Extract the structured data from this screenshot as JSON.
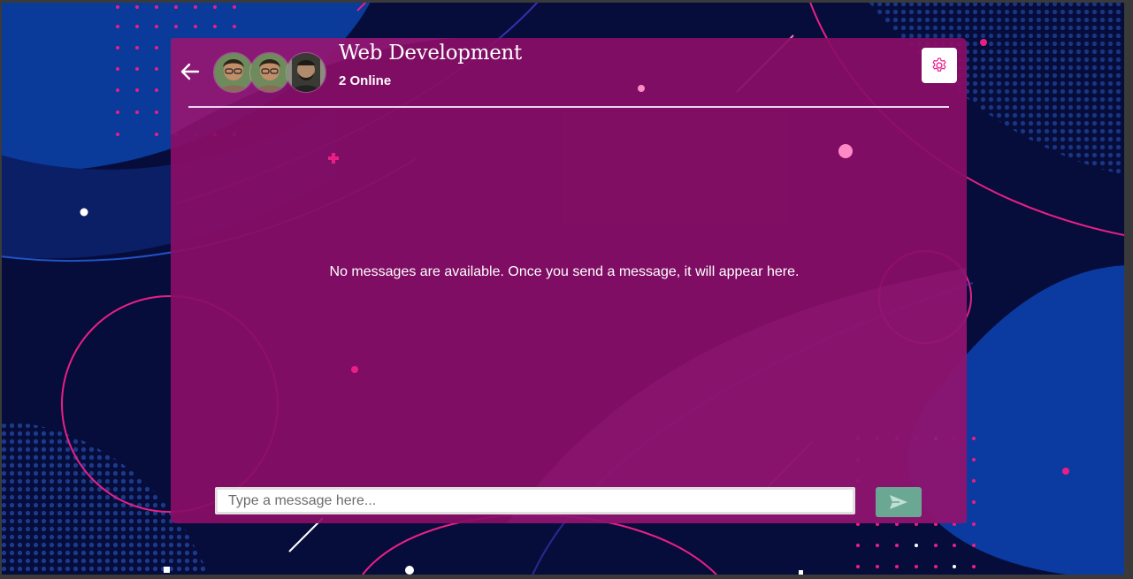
{
  "chat": {
    "title": "Web Development",
    "online_status": "2 Online",
    "empty_message": "No messages are available. Once you send a message, it will appear here.",
    "members": [
      {
        "avatar": "member-avatar-1"
      },
      {
        "avatar": "member-avatar-2"
      },
      {
        "avatar": "member-avatar-3"
      }
    ]
  },
  "composer": {
    "placeholder": "Type a message here...",
    "value": ""
  },
  "icons": {
    "back": "arrow-left-icon",
    "settings": "gear-icon",
    "send": "send-icon"
  },
  "colors": {
    "card": "#890e66",
    "accent": "#e91e8c",
    "send_button": "#6aa893",
    "background": "#0a0f3a"
  }
}
